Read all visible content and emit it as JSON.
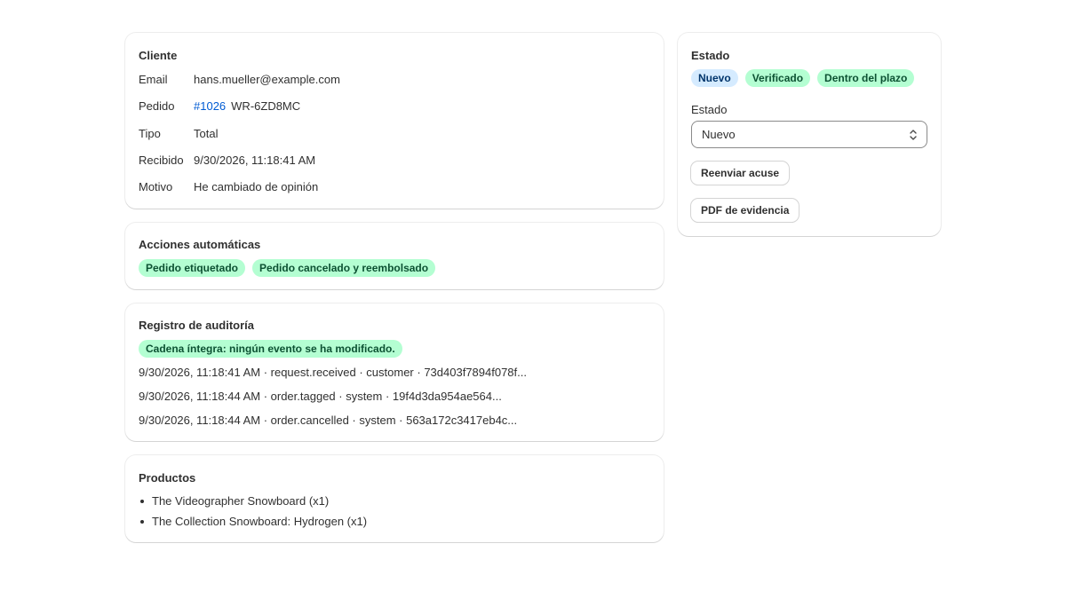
{
  "customer": {
    "title": "Cliente",
    "rows": [
      {
        "label": "Email",
        "value": "hans.mueller@example.com"
      },
      {
        "label": "Pedido",
        "link": "#1026",
        "value": "WR-6ZD8MC"
      },
      {
        "label": "Tipo",
        "value": "Total"
      },
      {
        "label": "Recibido",
        "value": "9/30/2026, 11:18:41 AM"
      },
      {
        "label": "Motivo",
        "value": "He cambiado de opinión"
      }
    ]
  },
  "auto_actions": {
    "title": "Acciones automáticas",
    "badges": [
      "Pedido etiquetado",
      "Pedido cancelado y reembolsado"
    ]
  },
  "audit": {
    "title": "Registro de auditoría",
    "integrity_badge": "Cadena íntegra: ningún evento se ha modificado.",
    "events": [
      "9/30/2026, 11:18:41 AM · request.received · customer · 73d403f7894f078f...",
      "9/30/2026, 11:18:44 AM · order.tagged · system · 19f4d3da954ae564...",
      "9/30/2026, 11:18:44 AM · order.cancelled · system · 563a172c3417eb4c..."
    ]
  },
  "products": {
    "title": "Productos",
    "items": [
      "The Videographer Snowboard (x1)",
      "The Collection Snowboard: Hydrogen (x1)"
    ]
  },
  "status": {
    "title": "Estado",
    "badges": [
      {
        "label": "Nuevo",
        "tone": "info"
      },
      {
        "label": "Verificado",
        "tone": "success"
      },
      {
        "label": "Dentro del plazo",
        "tone": "success"
      }
    ],
    "select_label": "Estado",
    "select_value": "Nuevo",
    "resend_button": "Reenviar acuse",
    "pdf_button": "PDF de evidencia"
  }
}
